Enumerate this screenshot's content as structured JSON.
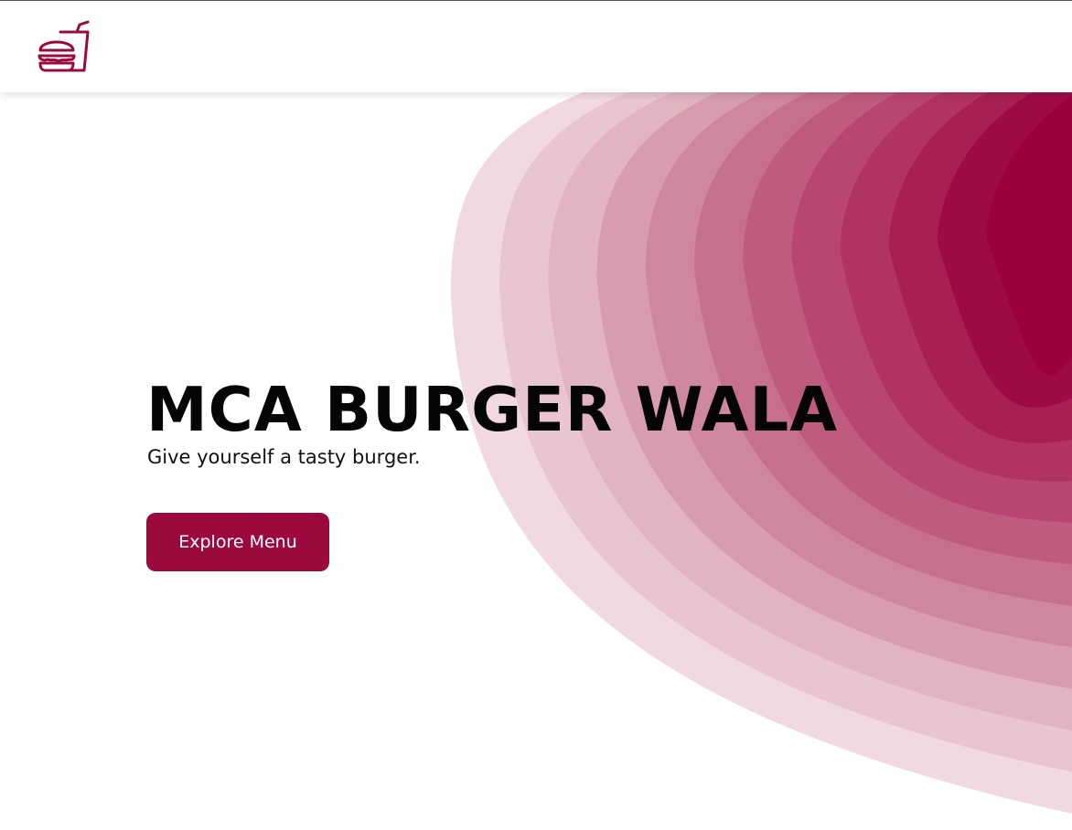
{
  "header": {
    "logo_icon": "burger-and-drink-icon"
  },
  "hero": {
    "title": "MCA BURGER WALA",
    "subtitle": "Give yourself a tasty burger.",
    "cta_label": "Explore Menu"
  },
  "colors": {
    "accent": "#9c0a3d",
    "blob_layers": [
      "#f0d9df",
      "#e9c5cf",
      "#e2b3c1",
      "#d89cb0",
      "#cf879f",
      "#c76f8e",
      "#bf5b7f",
      "#b84670",
      "#b03362",
      "#a71f53",
      "#9e0b44",
      "#9a003c"
    ]
  }
}
